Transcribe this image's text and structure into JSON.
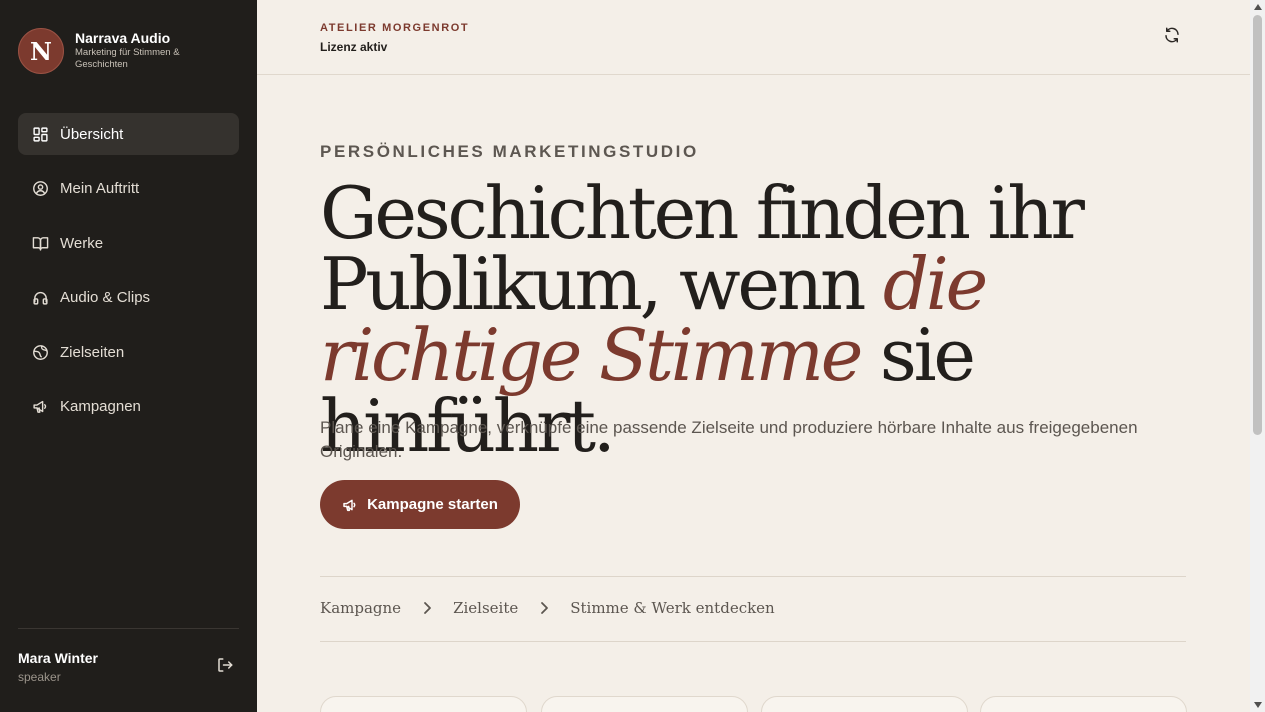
{
  "sidebar": {
    "logo_letter": "N",
    "brand_name": "Narrava Audio",
    "brand_tagline": "Marketing für Stimmen & Geschichten",
    "items": [
      {
        "label": "Übersicht",
        "icon": "dashboard-icon",
        "active": true
      },
      {
        "label": "Mein Auftritt",
        "icon": "user-circle-icon"
      },
      {
        "label": "Werke",
        "icon": "open-book-icon"
      },
      {
        "label": "Audio & Clips",
        "icon": "headphones-icon"
      },
      {
        "label": "Zielseiten",
        "icon": "globe-icon"
      },
      {
        "label": "Kampagnen",
        "icon": "megaphone-icon"
      }
    ],
    "user": {
      "name": "Mara Winter",
      "role": "speaker"
    }
  },
  "header": {
    "organization": "ATELIER MORGENROT",
    "license_status": "Lizenz aktiv"
  },
  "hero": {
    "eyebrow": "PERSÖNLICHES MARKETINGSTUDIO",
    "headline_part1": "Geschichten finden ihr Publikum, wenn ",
    "headline_accent1": "die richtige",
    "headline_accent2": "Stimme",
    "headline_part2": " sie hinführt.",
    "lead": "Plane eine Kampagne, verknüpfe eine passende Zielseite und produziere hörbare Inhalte aus freigegebenen Originalen.",
    "cta_label": "Kampagne starten"
  },
  "steps": [
    "Kampagne",
    "Zielseite",
    "Stimme & Werk entdecken"
  ],
  "colors": {
    "accent": "#7c3a2e",
    "sidebar_bg": "#201e1b",
    "page_bg": "#f4efe8"
  }
}
